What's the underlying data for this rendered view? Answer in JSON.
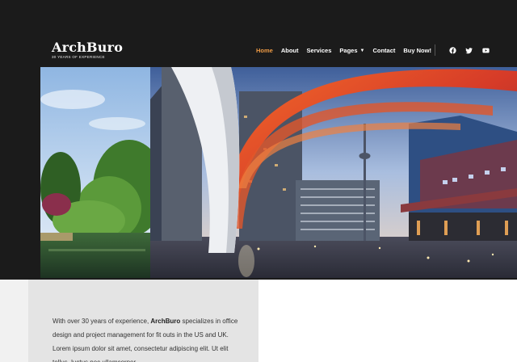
{
  "brand": {
    "name": "ArchBuro",
    "tagline": "30 YEARS OF EXPERIENCE"
  },
  "nav": {
    "items": [
      {
        "label": "Home",
        "active": true
      },
      {
        "label": "About"
      },
      {
        "label": "Services"
      },
      {
        "label": "Pages",
        "has_dropdown": true
      },
      {
        "label": "Contact"
      },
      {
        "label": "Buy Now!"
      }
    ],
    "social": [
      {
        "icon": "facebook-icon"
      },
      {
        "icon": "twitter-icon"
      },
      {
        "icon": "youtube-icon"
      }
    ]
  },
  "hero": {
    "image": "architecture-photo-collage"
  },
  "intro": {
    "before": "With over 30 years of experience, ",
    "brand": "ArchBuro",
    "after": " specializes in office design and project management for fit outs in the US and UK.  Lorem ipsum dolor sit amet, consectetur adipiscing elit. Ut elit tellus, luctus nec ullamcorper"
  },
  "colors": {
    "accent": "#ee9b45",
    "header_bg": "#1b1b1b",
    "text_panel_bg": "#e4e4e4"
  }
}
